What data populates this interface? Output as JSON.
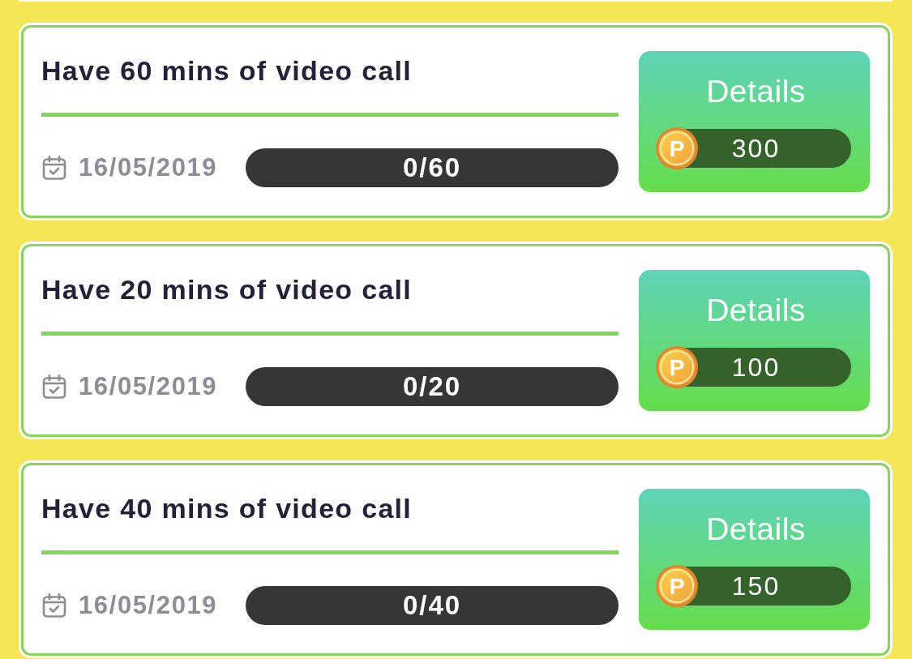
{
  "tasks": [
    {
      "title": "Have 60 mins of video call",
      "date": "16/05/2019",
      "progress": "0/60",
      "button": "Details",
      "coin_label": "P",
      "points": "300"
    },
    {
      "title": "Have 20 mins of video call",
      "date": "16/05/2019",
      "progress": "0/20",
      "button": "Details",
      "coin_label": "P",
      "points": "100"
    },
    {
      "title": "Have 40 mins of video call",
      "date": "16/05/2019",
      "progress": "0/40",
      "button": "Details",
      "coin_label": "P",
      "points": "150"
    }
  ]
}
